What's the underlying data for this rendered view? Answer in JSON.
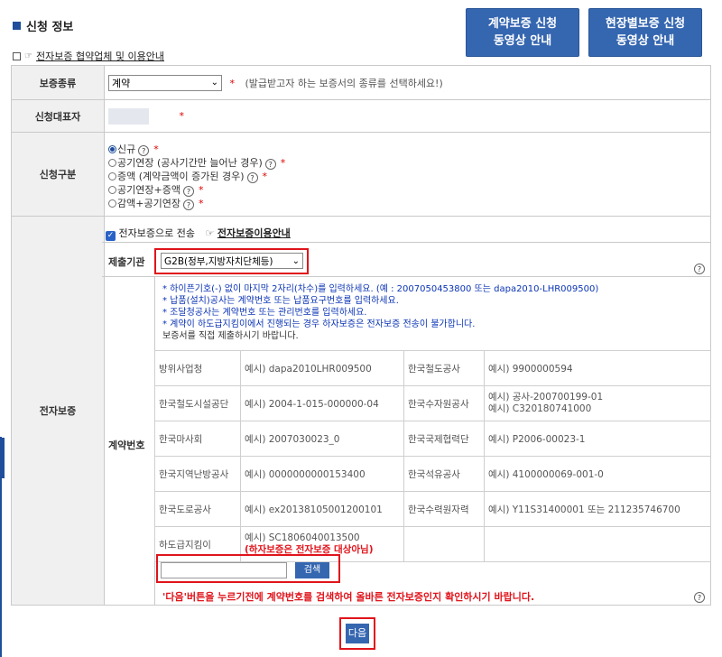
{
  "page": {
    "title": "신청 정보",
    "sublink": "전자보증 협약업체 및 이용안내",
    "btn_contract_video": "계약보증 신청\n동영상 안내",
    "btn_site_video": "현장별보증 신청\n동영상 안내"
  },
  "form": {
    "guarantee_type_label": "보증종류",
    "guarantee_type_value": "계약",
    "guarantee_type_hint": "(발급받고자 하는 보증서의 종류를 선택하세요!)",
    "applicant_rep_label": "신청대표자",
    "app_type_label": "신청구분",
    "app_types": [
      {
        "label": "신규",
        "selected": true
      },
      {
        "label": "공기연장 (공사기간만 늘어난 경우)",
        "selected": false
      },
      {
        "label": "증액 (계약금액이 증가된 경우)",
        "selected": false
      },
      {
        "label": "공기연장+증액",
        "selected": false
      },
      {
        "label": "감액+공기연장",
        "selected": false
      }
    ],
    "e_guarantee_label": "전자보증",
    "e_send_label": "전자보증으로 전송",
    "e_guide_link": "전자보증이용안내",
    "submit_org_label": "제출기관",
    "submit_org_value": "G2B(정부,지방자치단체등)",
    "contract_no_label": "계약번호",
    "notes": [
      "* 하이픈기호(-) 없이 마지막 2자리(차수)를 입력하세요. (예 : 2007050453800 또는 dapa2010-LHR009500)",
      "* 납품(설치)공사는 계약번호 또는 납품요구번호를 입력하세요.",
      "* 조달청공사는 계약번호 또는 관리번호를 입력하세요.",
      "* 계약이 하도급지킴이에서 진행되는 경우 하자보증은 전자보증 전송이 불가합니다.",
      "보증서를 직접 제출하시기 바랍니다."
    ],
    "examples": [
      [
        "방위사업청",
        "예시) dapa2010LHR009500",
        "한국철도공사",
        "예시) 9900000594"
      ],
      [
        "한국철도시설공단",
        "예시) 2004-1-015-000000-04",
        "한국수자원공사",
        "예시) 공사-200700199-01\n예시) C320180741000"
      ],
      [
        "한국마사회",
        "예시) 2007030023_0",
        "한국국제협력단",
        "예시) P2006-00023-1"
      ],
      [
        "한국지역난방공사",
        "예시) 0000000000153400",
        "한국석유공사",
        "예시) 4100000069-001-0"
      ],
      [
        "한국도로공사",
        "예시) ex20138105001200101",
        "한국수력원자력",
        "예시) Y11S31400001 또는 211235746700"
      ]
    ],
    "last_example_org": "하도급지킴이",
    "last_example_value": "예시) SC1806040013500",
    "last_example_note": "(하자보증은 전자보증 대상아님)",
    "search_btn": "검색",
    "warning": "'다음'버튼을 누르기전에 계약번호를 검색하여 올바른 전자보증인지 확인하시기 바랍니다.",
    "next_btn": "다음"
  },
  "colors": {
    "accent": "#3566b0",
    "required": "#dd0000",
    "highlight": "#e0141b",
    "note": "#0b34b5"
  }
}
